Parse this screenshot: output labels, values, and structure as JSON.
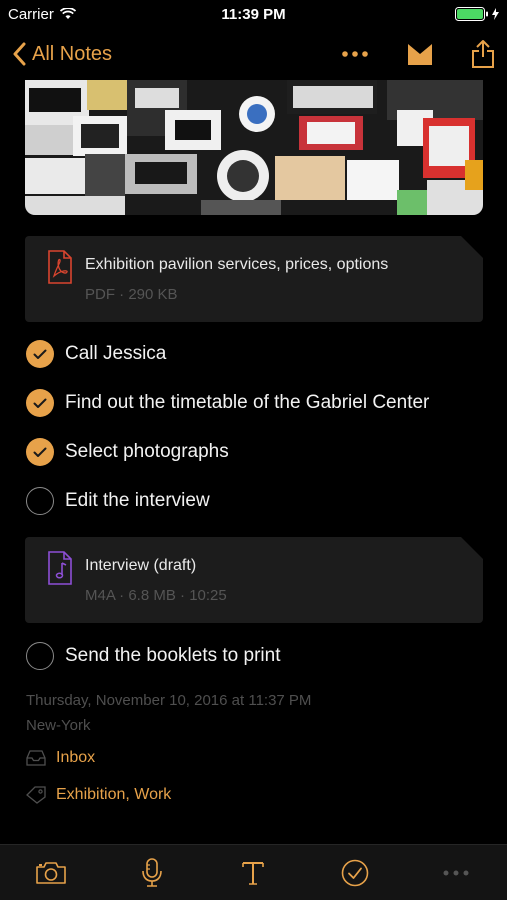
{
  "status": {
    "carrier": "Carrier",
    "time": "11:39 PM"
  },
  "nav": {
    "back_label": "All Notes"
  },
  "attachments": [
    {
      "icon": "pdf-icon",
      "title": "Exhibition pavilion services, prices, options",
      "subtitle": "PDF · 290 KB"
    },
    {
      "icon": "audio-file-icon",
      "title": "Interview (draft)",
      "subtitle": "M4A · 6.8 MB · 10:25"
    }
  ],
  "tasks": [
    {
      "label": "Call Jessica",
      "done": true
    },
    {
      "label": "Find out the timetable of the Gabriel Center",
      "done": true
    },
    {
      "label": "Select photographs",
      "done": true
    },
    {
      "label": "Edit the interview",
      "done": false
    },
    {
      "label": "Send the booklets to print",
      "done": false
    }
  ],
  "meta": {
    "date": "Thursday, November 10, 2016 at 11:37 PM",
    "location": "New-York",
    "notebook": "Inbox",
    "tags": "Exhibition, Work"
  },
  "colors": {
    "accent": "#e7a24a",
    "background": "#000000",
    "card": "#1c1c1c",
    "audio_icon": "#8d4fd6",
    "pdf_icon": "#d9452f"
  }
}
